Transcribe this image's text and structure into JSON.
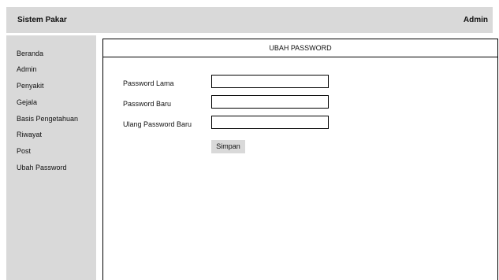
{
  "header": {
    "app_title": "Sistem Pakar",
    "user": "Admin"
  },
  "sidebar": {
    "items": [
      {
        "label": "Beranda"
      },
      {
        "label": "Admin"
      },
      {
        "label": "Penyakit"
      },
      {
        "label": "Gejala"
      },
      {
        "label": "Basis Pengetahuan"
      },
      {
        "label": "Riwayat"
      },
      {
        "label": "Post"
      },
      {
        "label": "Ubah Password"
      }
    ]
  },
  "main": {
    "title": "UBAH PASSWORD",
    "fields": [
      {
        "label": "Password Lama",
        "value": "",
        "placeholder": ""
      },
      {
        "label": "Password Baru",
        "value": "",
        "placeholder": ""
      },
      {
        "label": "Ulang Password Baru",
        "value": "",
        "placeholder": ""
      }
    ],
    "save_label": "Simpan"
  },
  "colors": {
    "panel_gray": "#d9d9d9",
    "border": "#000000",
    "background": "#ffffff"
  }
}
